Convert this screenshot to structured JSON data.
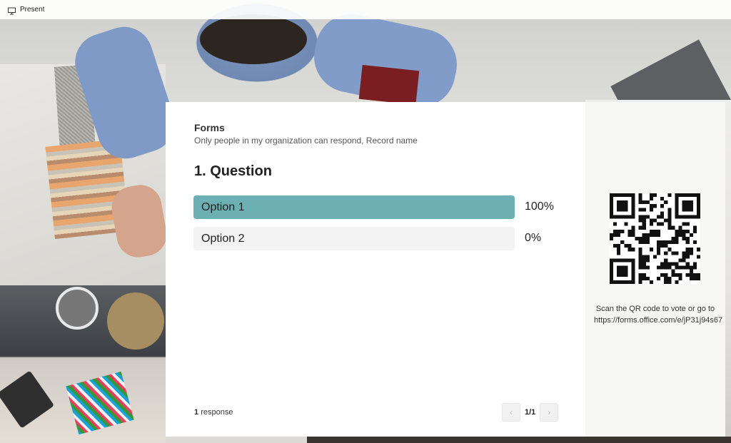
{
  "topbar": {
    "present_label": "Present",
    "present_icon": "monitor-icon"
  },
  "form": {
    "title": "Forms",
    "subtitle": "Only people in my organization can respond, Record name",
    "question": "1. Question",
    "options": [
      {
        "label": "Option 1",
        "percent_text": "100%",
        "fraction": 1.0
      },
      {
        "label": "Option 2",
        "percent_text": "0%",
        "fraction": 0.0
      }
    ],
    "responses_count": "1",
    "responses_word": "response",
    "pager": {
      "current": "1/1",
      "prev_icon": "chevron-left-icon",
      "next_icon": "chevron-right-icon"
    }
  },
  "qr": {
    "instructions": "Scan the QR code to vote or go to https://forms.office.com/e/jP31j94s67"
  },
  "colors": {
    "bar_fill": "#6db0b3",
    "bar_track": "#f3f3f3"
  }
}
